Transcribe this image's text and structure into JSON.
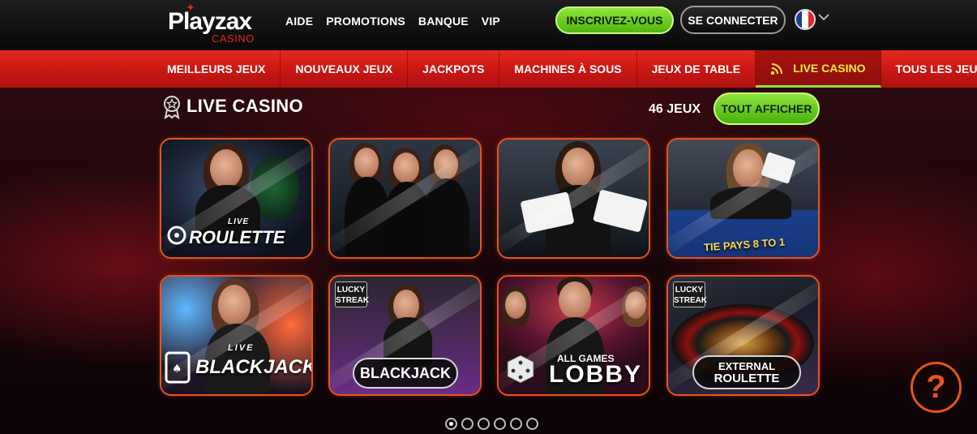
{
  "brand": {
    "name": "Playzax",
    "sub": "CASINO",
    "accent": "#e1261c"
  },
  "topnav": {
    "items": [
      "AIDE",
      "PROMOTIONS",
      "BANQUE",
      "VIP"
    ]
  },
  "actions": {
    "register": "INSCRIVEZ-VOUS",
    "login": "SE CONNECTER",
    "language_flag": "france-flag"
  },
  "categories": {
    "items": [
      "MEILLEURS JEUX",
      "NOUVEAUX JEUX",
      "JACKPOTS",
      "MACHINES À SOUS",
      "JEUX DE TABLE",
      "LIVE CASINO",
      "TOUS LES JEUX"
    ],
    "active": "LIVE CASINO"
  },
  "section": {
    "title": "LIVE CASINO",
    "count": "46 JEUX",
    "view_all": "TOUT AFFICHER"
  },
  "tiles": {
    "t1": {
      "live": "LIVE",
      "label": "ROULETTE"
    },
    "t4": {
      "label": "TIE PAYS 8 TO 1"
    },
    "t5": {
      "live": "LIVE",
      "label": "BLACKJACK"
    },
    "t6": {
      "badge1": "LUCKY",
      "badge2": "STREAK",
      "label": "BLACKJACK"
    },
    "t7": {
      "line1": "ALL GAMES",
      "line2": "LOBBY"
    },
    "t8": {
      "badge1": "LUCKY",
      "badge2": "STREAK",
      "line1": "EXTERNAL",
      "line2": "ROULETTE"
    }
  },
  "pagination": {
    "pages": 6,
    "current": 1
  },
  "help": {
    "label": "?"
  },
  "colors": {
    "nav_red": "#d21c17",
    "green": "#6fd024",
    "tile_border": "#e8541d",
    "active_text": "#f3e73c"
  }
}
